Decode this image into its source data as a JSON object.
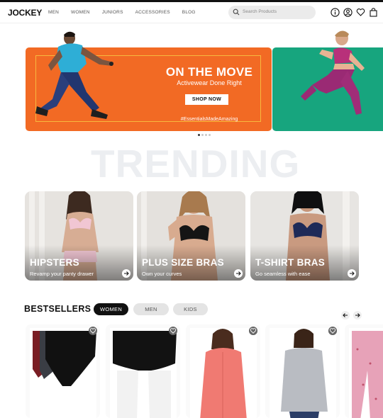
{
  "header": {
    "logo": "JOCKEY",
    "nav": [
      "MEN",
      "WOMEN",
      "JUNIORS",
      "ACCESSORIES",
      "BLOG"
    ],
    "search_placeholder": "Search Products",
    "icons": [
      "info-icon",
      "user-icon",
      "heart-icon",
      "bag-icon"
    ]
  },
  "hero": {
    "title": "ON THE MOVE",
    "subtitle": "Activewear Done Right",
    "cta": "SHOP NOW",
    "hashtag": "#EssentialsMadeAmazing",
    "slides": 4,
    "active_slide": 1,
    "colors": {
      "orange": "#f26a24",
      "teal": "#17a57e"
    }
  },
  "trending": {
    "heading": "TRENDING",
    "cards": [
      {
        "title": "HIPSTERS",
        "subtitle": "Revamp your panty drawer"
      },
      {
        "title": "PLUS SIZE BRAS",
        "subtitle": "Own your curves"
      },
      {
        "title": "T-SHIRT BRAS",
        "subtitle": "Go seamless with ease"
      }
    ]
  },
  "bestsellers": {
    "title": "BESTSELLERS",
    "tabs": [
      "WOMEN",
      "MEN",
      "KIDS"
    ],
    "active_tab": "WOMEN",
    "products": [
      "hipster-briefs-multipack",
      "black-boyshort",
      "coral-hoodie",
      "grey-long-sleeve-tee",
      "pink-printed-pajama"
    ]
  }
}
